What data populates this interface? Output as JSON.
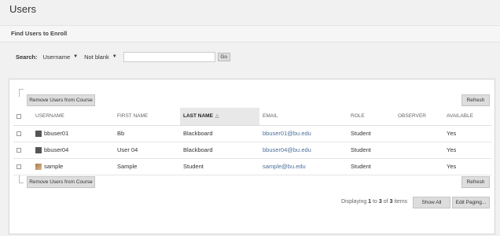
{
  "page": {
    "title": "Users"
  },
  "find": {
    "title": "Find Users to Enroll"
  },
  "search": {
    "label": "Search:",
    "field_select": "Username",
    "operator_select": "Not blank",
    "value": "",
    "go_label": "Go"
  },
  "actions": {
    "remove_label": "Remove Users from Course",
    "refresh_label": "Refresh"
  },
  "table": {
    "columns": [
      "USERNAME",
      "FIRST NAME",
      "LAST NAME",
      "EMAIL",
      "ROLE",
      "OBSERVER",
      "AVAILABLE"
    ],
    "sorted_column": "LAST NAME",
    "rows": [
      {
        "username": "bbuser01",
        "first": "Bb",
        "last": "Blackboard",
        "email": "bbuser01@bu.edu",
        "role": "Student",
        "observer": "",
        "available": "Yes",
        "avatar": "dark"
      },
      {
        "username": "bbuser04",
        "first": "User 04",
        "last": "Blackboard",
        "email": "bbuser04@bu.edu",
        "role": "Student",
        "observer": "",
        "available": "Yes",
        "avatar": "dark"
      },
      {
        "username": "sample",
        "first": "Sample",
        "last": "Student",
        "email": "sample@bu.edu",
        "role": "Student",
        "observer": "",
        "available": "Yes",
        "avatar": "photo"
      }
    ]
  },
  "footer": {
    "displaying": "Displaying",
    "from": "1",
    "to_word": "to",
    "to": "3",
    "of_word": "of",
    "total": "3",
    "items_word": "items",
    "show_all_label": "Show All",
    "edit_paging_label": "Edit Paging..."
  }
}
